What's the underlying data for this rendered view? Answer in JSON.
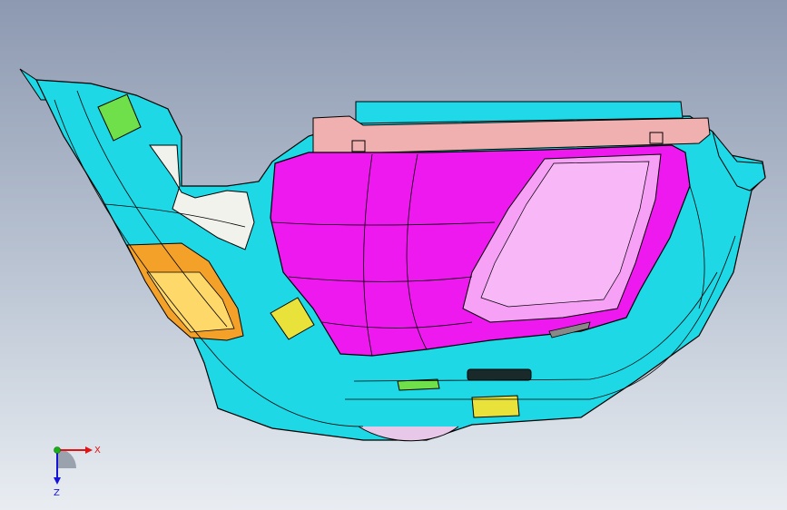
{
  "viewport": {
    "background_top": "#8d99b1",
    "background_bottom": "#e9edf2"
  },
  "model": {
    "colors": {
      "trim_panel": "#1ed8e6",
      "map_pocket": "#ee19ee",
      "armrest_insert": "#f6a0f6",
      "upper_rail": "#f0b0b0",
      "green_clip": "#6fe04a",
      "amber_reflector": "#f4a12a",
      "yellow_bracket": "#e8e23a",
      "white_insert": "#f2f2ec",
      "linework": "#000000"
    }
  },
  "triad": {
    "x_label": "X",
    "z_label": "Z",
    "x_color": "#e01414",
    "y_color": "#18b018",
    "z_color": "#1414d8"
  }
}
